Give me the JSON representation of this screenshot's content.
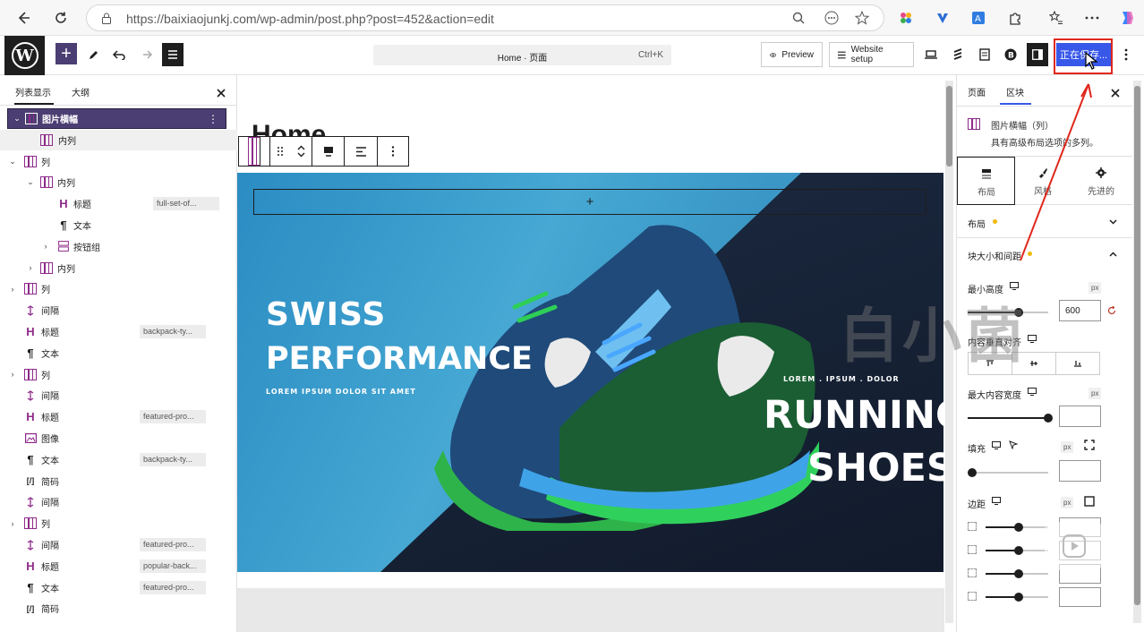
{
  "browser": {
    "url": "https://baixiaojunkj.com/wp-admin/post.php?post=452&action=edit"
  },
  "toolbar": {
    "command_title": "Home · 页面",
    "command_shortcut": "Ctrl+K",
    "preview_label": "Preview",
    "website_setup_label": "Website setup",
    "save_label": "正在保存..."
  },
  "left_panel": {
    "tabs": [
      "列表显示",
      "大纲"
    ],
    "rows": [
      {
        "label": "图片横幅",
        "tag": "",
        "selected": true
      },
      {
        "label": "内列",
        "tag": ""
      },
      {
        "label": "列",
        "tag": ""
      },
      {
        "label": "内列",
        "tag": ""
      },
      {
        "label": "标题",
        "tag": "full-set-of..."
      },
      {
        "label": "文本",
        "tag": ""
      },
      {
        "label": "按钮组",
        "tag": ""
      },
      {
        "label": "内列",
        "tag": ""
      },
      {
        "label": "列",
        "tag": ""
      },
      {
        "label": "间隔",
        "tag": ""
      },
      {
        "label": "标题",
        "tag": "backpack-ty..."
      },
      {
        "label": "文本",
        "tag": ""
      },
      {
        "label": "列",
        "tag": ""
      },
      {
        "label": "间隔",
        "tag": ""
      },
      {
        "label": "标题",
        "tag": "featured-pro..."
      },
      {
        "label": "图像",
        "tag": ""
      },
      {
        "label": "文本",
        "tag": "backpack-ty..."
      },
      {
        "label": "简码",
        "tag": ""
      },
      {
        "label": "间隔",
        "tag": ""
      },
      {
        "label": "列",
        "tag": ""
      },
      {
        "label": "间隔",
        "tag": "featured-pro..."
      },
      {
        "label": "标题",
        "tag": "popular-back..."
      },
      {
        "label": "文本",
        "tag": "featured-pro..."
      },
      {
        "label": "简码",
        "tag": ""
      }
    ]
  },
  "canvas": {
    "page_title": "Home",
    "hero": {
      "line1": "SWISS",
      "line2": "PERFORMANCE",
      "sub": "LOREM IPSUM DOLOR SIT AMET",
      "right_sub": "LOREM . IPSUM . DOLOR",
      "right1": "RUNNING",
      "right2": "SHOES"
    }
  },
  "right_panel": {
    "tabs": [
      "页面",
      "区块"
    ],
    "block_name": "图片横幅（列）",
    "block_desc": "具有高级布局选项的多列。",
    "subtabs": [
      "布局",
      "风格",
      "先进的"
    ],
    "section_layout": "布局",
    "section_size": "块大小和间距",
    "min_height_label": "最小高度",
    "min_height_value": "600",
    "unit": "px",
    "content_align_label": "内容垂直对齐",
    "max_width_label": "最大内容宽度",
    "padding_label": "填充",
    "margin_label": "边距"
  },
  "watermark": "白小菌",
  "colors": {
    "wp_admin_dark": "#1e1e1e",
    "save_blue": "#3858e9",
    "block_purple": "#8e2a8a",
    "highlight_red": "#e0271b"
  }
}
